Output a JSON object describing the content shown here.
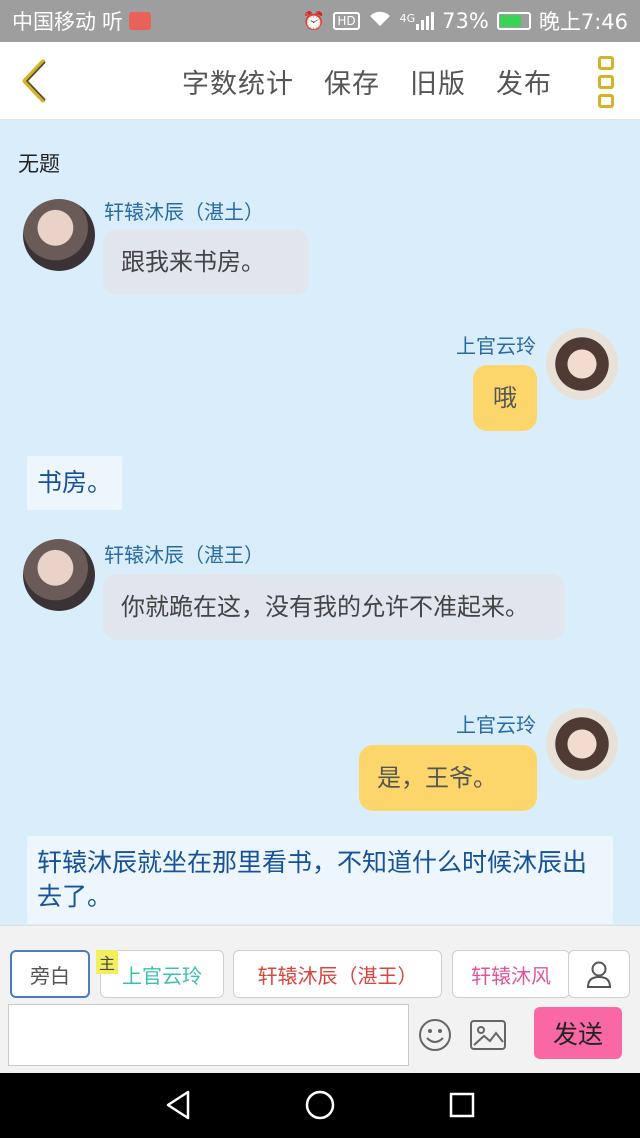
{
  "status_bar": {
    "carrier": "中国移动",
    "carrier_app": "听",
    "signal": "4G",
    "battery_pct": "73%",
    "time": "晚上7:46"
  },
  "toolbar": {
    "items": [
      "字数统计",
      "保存",
      "旧版",
      "发布"
    ]
  },
  "chat": {
    "title": "无题",
    "messages": [
      {
        "type": "left",
        "name": "轩辕沐辰（湛土）",
        "text": "跟我来书房。"
      },
      {
        "type": "right",
        "name": "上官云玲",
        "text": "哦"
      },
      {
        "type": "narration",
        "text": "书房。"
      },
      {
        "type": "left",
        "name": "轩辕沐辰（湛王）",
        "text": "你就跪在这，没有我的允许不准起来。"
      },
      {
        "type": "right",
        "name": "上官云玲",
        "text": "是，王爷。"
      },
      {
        "type": "narration",
        "text": "轩辕沐辰就坐在那里看书，不知道什么时候沐辰出去了。"
      }
    ]
  },
  "input_bar": {
    "roles": [
      {
        "label": "旁白",
        "color": "#555555"
      },
      {
        "label": "上官云玲",
        "color": "#3cbfb0"
      },
      {
        "label": "轩辕沐辰（湛王）",
        "color": "#d9453d"
      },
      {
        "label": "轩辕沐风",
        "color": "#e0559b"
      }
    ],
    "main_badge": "主",
    "message_value": "",
    "send_label": "发送"
  },
  "colors": {
    "accent_yellow": "#fcd66b",
    "send_pink": "#f968a5",
    "chat_bg": "#d9eefa"
  }
}
